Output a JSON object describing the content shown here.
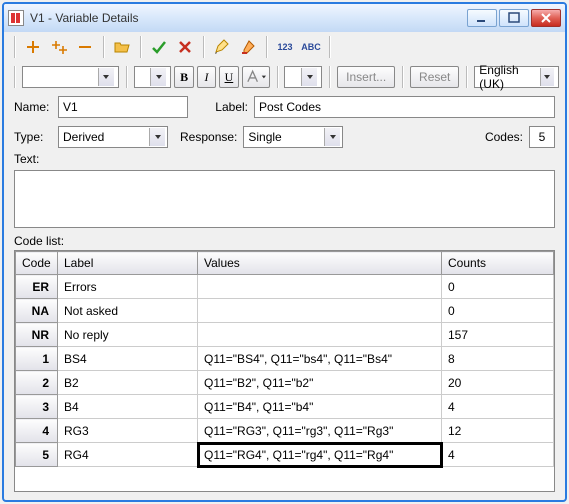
{
  "window": {
    "title": "V1 - Variable Details"
  },
  "toolbar": {
    "plus": "plus",
    "plusplus": "plusplus",
    "minus": "minus",
    "folder": "folder",
    "check": "check",
    "cross": "cross",
    "edit": "edit",
    "brush": "brush",
    "num": "123",
    "abc": "ABC"
  },
  "fmt": {
    "bold": "B",
    "italic": "I",
    "underline": "U",
    "insert": "Insert...",
    "reset": "Reset",
    "lang": "English (UK)"
  },
  "fields": {
    "name_lbl": "Name:",
    "name_val": "V1",
    "label_lbl": "Label:",
    "label_val": "Post Codes",
    "type_lbl": "Type:",
    "type_val": "Derived",
    "response_lbl": "Response:",
    "response_val": "Single",
    "codes_lbl": "Codes:",
    "codes_val": "5",
    "text_lbl": "Text:",
    "codelist_lbl": "Code list:"
  },
  "grid": {
    "headers": {
      "code": "Code",
      "label": "Label",
      "values": "Values",
      "counts": "Counts"
    },
    "rows": [
      {
        "code": "ER",
        "label": "Errors",
        "values": "",
        "counts": "0"
      },
      {
        "code": "NA",
        "label": "Not asked",
        "values": "",
        "counts": "0"
      },
      {
        "code": "NR",
        "label": "No reply",
        "values": "",
        "counts": "157"
      },
      {
        "code": "1",
        "label": "BS4",
        "values": "Q11=\"BS4\", Q11=\"bs4\", Q11=\"Bs4\"",
        "counts": "8"
      },
      {
        "code": "2",
        "label": "B2",
        "values": "Q11=\"B2\", Q11=\"b2\"",
        "counts": "20"
      },
      {
        "code": "3",
        "label": "B4",
        "values": "Q11=\"B4\", Q11=\"b4\"",
        "counts": "4"
      },
      {
        "code": "4",
        "label": "RG3",
        "values": "Q11=\"RG3\", Q11=\"rg3\", Q11=\"Rg3\"",
        "counts": "12"
      },
      {
        "code": "5",
        "label": "RG4",
        "values": "Q11=\"RG4\", Q11=\"rg4\", Q11=\"Rg4\"",
        "counts": "4",
        "highlight": "values"
      }
    ]
  }
}
